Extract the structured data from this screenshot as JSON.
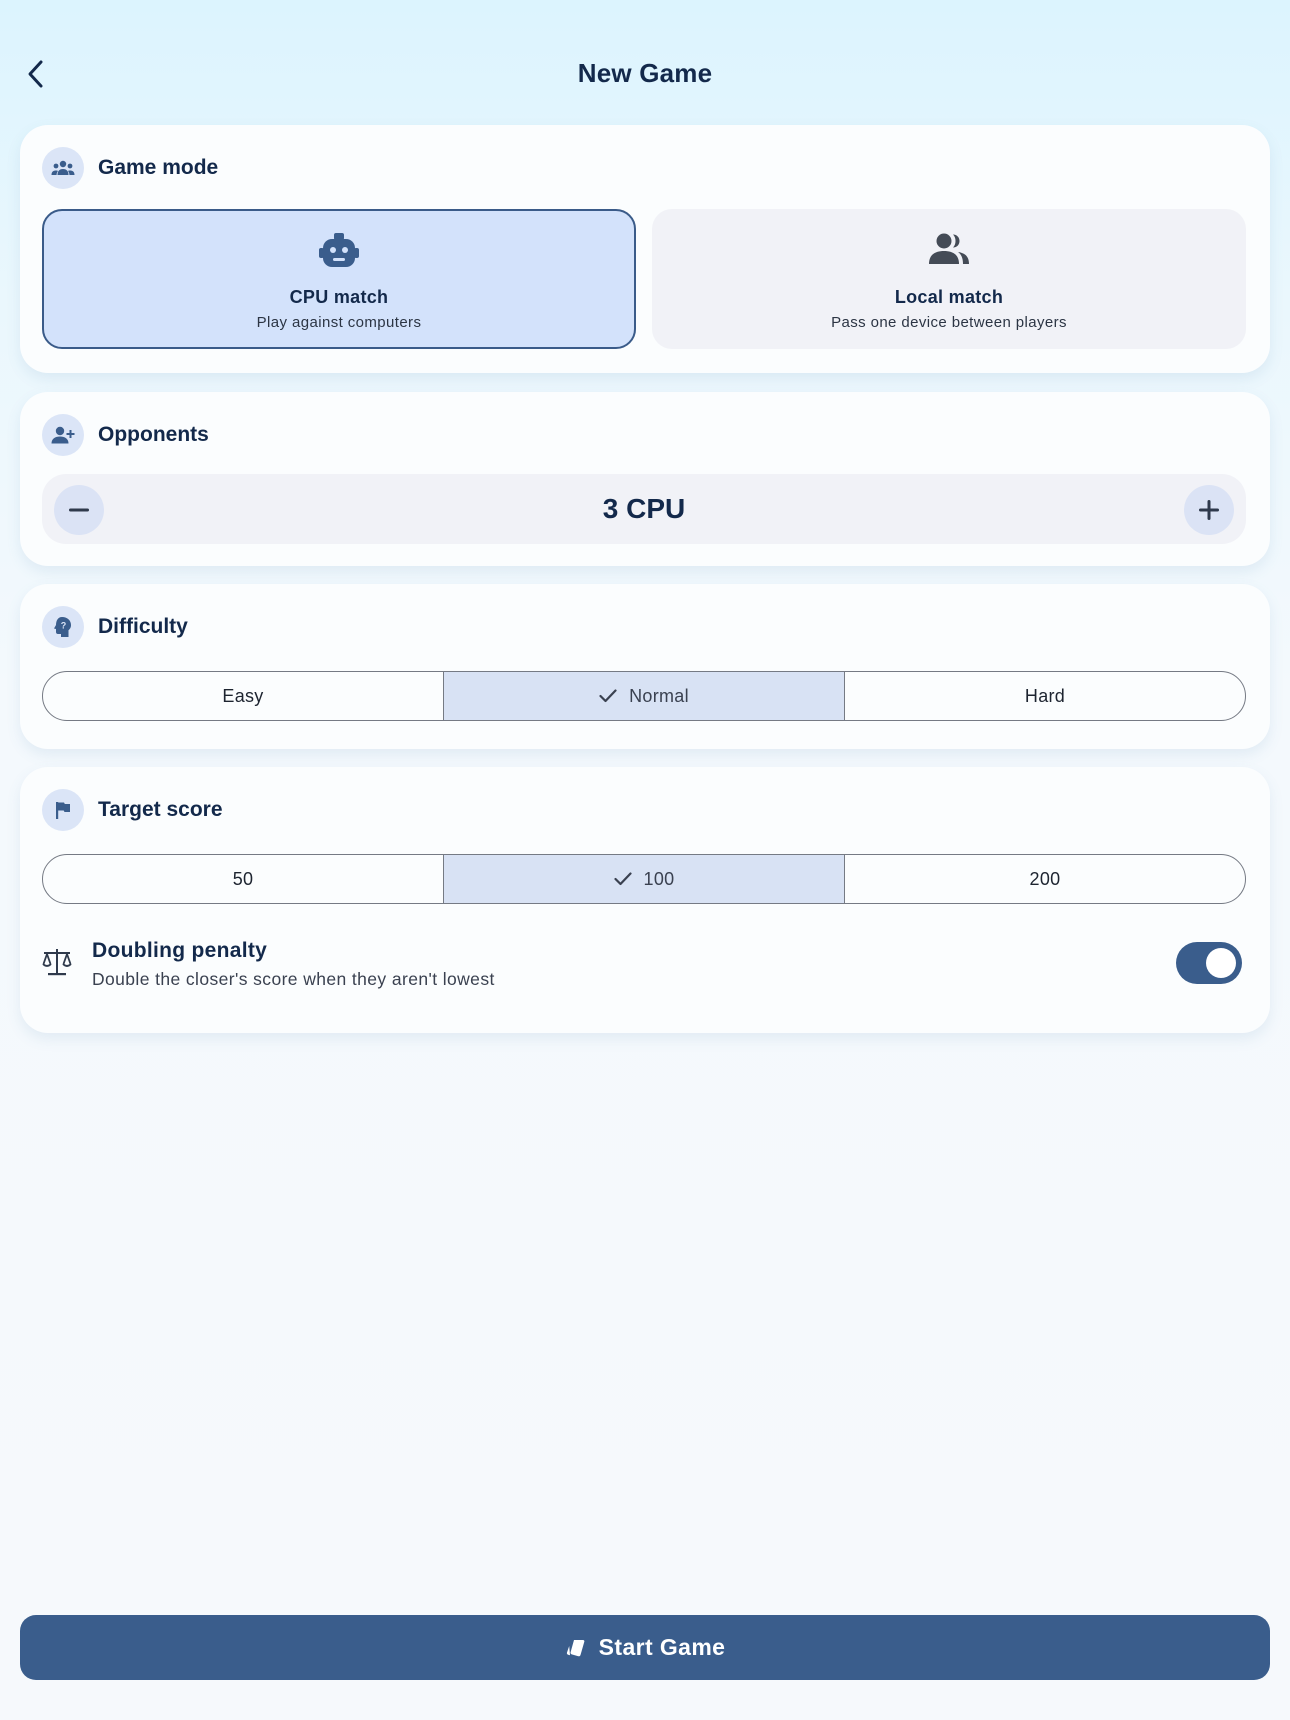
{
  "header": {
    "title": "New Game",
    "back_icon": "chevron-left-icon"
  },
  "game_mode": {
    "title": "Game mode",
    "icon": "group-icon",
    "options": [
      {
        "label": "CPU match",
        "description": "Play against computers",
        "icon": "robot-icon",
        "selected": true
      },
      {
        "label": "Local match",
        "description": "Pass one device between players",
        "icon": "people-icon",
        "selected": false
      }
    ]
  },
  "opponents": {
    "title": "Opponents",
    "icon": "person-add-icon",
    "value": "3 CPU",
    "decrement_icon": "minus-icon",
    "increment_icon": "plus-icon"
  },
  "difficulty": {
    "title": "Difficulty",
    "icon": "brain-question-icon",
    "options": [
      "Easy",
      "Normal",
      "Hard"
    ],
    "selected": "Normal"
  },
  "target_score": {
    "title": "Target score",
    "icon": "flag-icon",
    "options": [
      "50",
      "100",
      "200"
    ],
    "selected": "100"
  },
  "doubling_penalty": {
    "title": "Doubling penalty",
    "description": "Double the closer's score when they aren't lowest",
    "icon": "balance-scale-icon",
    "enabled": true
  },
  "start_button": {
    "label": "Start Game",
    "icon": "cards-icon"
  },
  "colors": {
    "primary": "#3a5d8c",
    "selected_tile": "#d3e2fb",
    "selected_segment": "#d8e2f4",
    "title_text": "#13294b"
  }
}
